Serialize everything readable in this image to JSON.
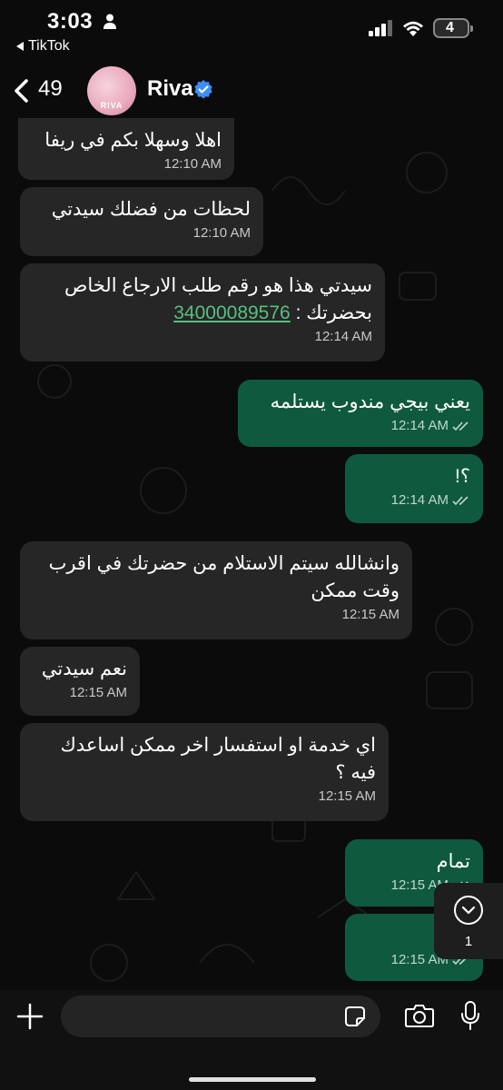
{
  "status_bar": {
    "time": "3:03",
    "back_app": "TikTok",
    "battery": "4"
  },
  "header": {
    "unread_count": "49",
    "contact_name": "Riva",
    "avatar_text": "RIVA"
  },
  "messages": [
    {
      "dir": "in",
      "text": "اهلا وسهلا بكم في ريفا",
      "time": "12:10 AM"
    },
    {
      "dir": "in",
      "text": "لحظات من فضلك سيدتي",
      "time": "12:10 AM"
    },
    {
      "dir": "in",
      "text": "سيدتي هذا هو رقم طلب الارجاع الخاص بحضرتك :",
      "link": "34000089576",
      "time": "12:14 AM"
    },
    {
      "dir": "out",
      "text": "يعني بيجي مندوب يستلمه",
      "time": "12:14 AM"
    },
    {
      "dir": "out",
      "text": "؟!",
      "time": "12:14 AM"
    },
    {
      "dir": "in",
      "text": "وانشالله سيتم الاستلام من حضرتك في اقرب وقت ممكن",
      "time": "12:15 AM"
    },
    {
      "dir": "in",
      "text": "نعم سيدتي",
      "time": "12:15 AM"
    },
    {
      "dir": "in",
      "text": "اي خدمة او استفسار اخر ممكن اساعدك فيه ؟",
      "time": "12:15 AM"
    },
    {
      "dir": "out",
      "text": "تمام",
      "time": "12:15 AM"
    },
    {
      "dir": "out",
      "text": "كرا",
      "time": "12:15 AM"
    }
  ],
  "scroll_down": {
    "count": "1"
  },
  "input": {
    "placeholder": ""
  },
  "colors": {
    "incoming_bubble": "#262626",
    "outgoing_bubble": "#0f5a3e",
    "link": "#57c07e",
    "verified": "#3b8ff5"
  }
}
